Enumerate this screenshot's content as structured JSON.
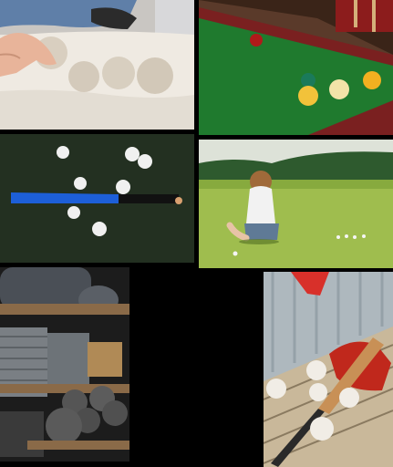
{
  "collage": {
    "background": "#000000",
    "tiles": [
      {
        "subject": "hand-placing-bocce-balls-on-sand",
        "dominant_color": "#e8e2d8"
      },
      {
        "subject": "billiard-balls-on-green-pool-table",
        "dominant_color": "#1f7a2e"
      },
      {
        "subject": "golf-balls-and-blue-bat-on-grass",
        "dominant_color": "#1d2a1c"
      },
      {
        "subject": "woman-sitting-on-lawn-with-balls",
        "dominant_color": "#9fbd4e"
      },
      {
        "subject": "shelves-with-folded-mats-and-medicine-balls",
        "dominant_color": "#2a2a2a"
      },
      {
        "subject": "baseball-bat-glove-and-balls-on-bench",
        "dominant_color": "#b0b8bd"
      }
    ]
  }
}
